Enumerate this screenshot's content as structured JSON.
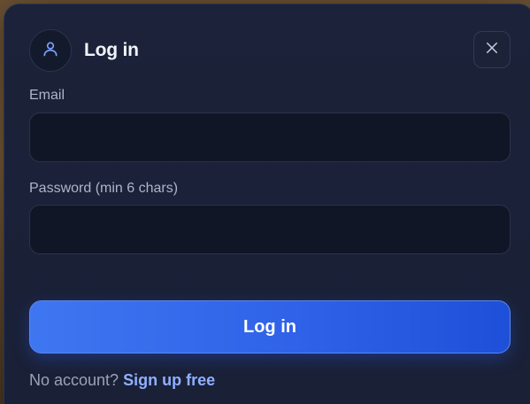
{
  "dialog": {
    "title": "Log in",
    "icons": {
      "avatar": "user-icon",
      "close": "close-icon"
    }
  },
  "form": {
    "email": {
      "label": "Email",
      "value": "",
      "placeholder": ""
    },
    "password": {
      "label": "Password (min 6 chars)",
      "value": "",
      "placeholder": ""
    },
    "submit_label": "Log in"
  },
  "footer": {
    "prompt": "No account?",
    "signup_link": "Sign up free"
  },
  "colors": {
    "accent": "#3f76f0",
    "link": "#8fb0ff",
    "modal_bg": "#1b2239"
  }
}
